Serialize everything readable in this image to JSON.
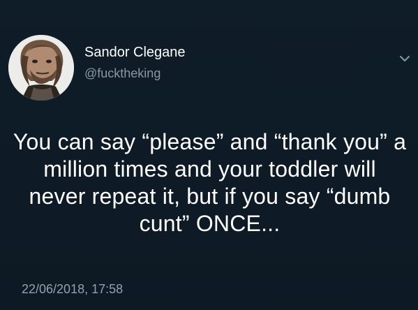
{
  "tweet": {
    "author_name": "Sandor Clegane",
    "author_handle": "@fucktheking",
    "text": "You can say “please” and “thank you” a million times and your toddler will never repeat it, but if you say “dumb cunt” ONCE...",
    "timestamp": "22/06/2018, 17:58",
    "menu_icon": "chevron-down-icon",
    "avatar_icon": "profile-photo-avatar",
    "background_color": "#0f1e2a",
    "text_color": "#ffffff",
    "secondary_text_color": "#8a98a5"
  }
}
